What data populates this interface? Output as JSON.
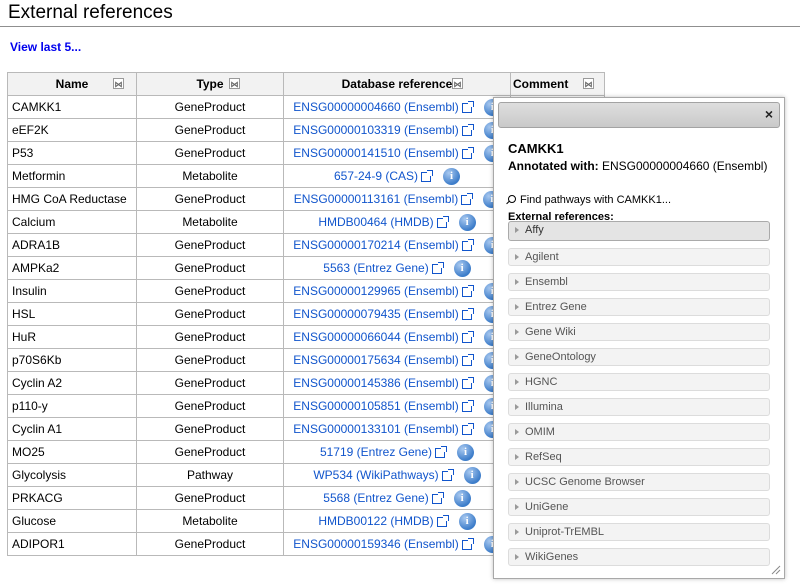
{
  "page": {
    "title": "External references",
    "view_last": "View last 5..."
  },
  "table": {
    "headers": {
      "name": "Name",
      "type": "Type",
      "dbref": "Database reference",
      "comment": "Comment"
    },
    "rows": [
      {
        "name": "CAMKK1",
        "type": "GeneProduct",
        "dbref": "ENSG00000004660 (Ensembl)"
      },
      {
        "name": "eEF2K",
        "type": "GeneProduct",
        "dbref": "ENSG00000103319 (Ensembl)"
      },
      {
        "name": "P53",
        "type": "GeneProduct",
        "dbref": "ENSG00000141510 (Ensembl)"
      },
      {
        "name": "Metformin",
        "type": "Metabolite",
        "dbref": "657-24-9 (CAS)"
      },
      {
        "name": "HMG CoA Reductase",
        "type": "GeneProduct",
        "dbref": "ENSG00000113161 (Ensembl)"
      },
      {
        "name": "Calcium",
        "type": "Metabolite",
        "dbref": "HMDB00464 (HMDB)"
      },
      {
        "name": "ADRA1B",
        "type": "GeneProduct",
        "dbref": "ENSG00000170214 (Ensembl)"
      },
      {
        "name": "AMPKa2",
        "type": "GeneProduct",
        "dbref": "5563 (Entrez Gene)"
      },
      {
        "name": "Insulin",
        "type": "GeneProduct",
        "dbref": "ENSG00000129965 (Ensembl)"
      },
      {
        "name": "HSL",
        "type": "GeneProduct",
        "dbref": "ENSG00000079435 (Ensembl)"
      },
      {
        "name": "HuR",
        "type": "GeneProduct",
        "dbref": "ENSG00000066044 (Ensembl)"
      },
      {
        "name": "p70S6Kb",
        "type": "GeneProduct",
        "dbref": "ENSG00000175634 (Ensembl)"
      },
      {
        "name": "Cyclin A2",
        "type": "GeneProduct",
        "dbref": "ENSG00000145386 (Ensembl)"
      },
      {
        "name": "p110-y",
        "type": "GeneProduct",
        "dbref": "ENSG00000105851 (Ensembl)"
      },
      {
        "name": "Cyclin A1",
        "type": "GeneProduct",
        "dbref": "ENSG00000133101 (Ensembl)"
      },
      {
        "name": "MO25",
        "type": "GeneProduct",
        "dbref": "51719 (Entrez Gene)"
      },
      {
        "name": "Glycolysis",
        "type": "Pathway",
        "dbref": "WP534 (WikiPathways)"
      },
      {
        "name": "PRKACG",
        "type": "GeneProduct",
        "dbref": "5568 (Entrez Gene)"
      },
      {
        "name": "Glucose",
        "type": "Metabolite",
        "dbref": "HMDB00122 (HMDB)"
      },
      {
        "name": "ADIPOR1",
        "type": "GeneProduct",
        "dbref": "ENSG00000159346 (Ensembl)"
      }
    ]
  },
  "popup": {
    "close": "×",
    "title": "CAMKK1",
    "annotated_label": "Annotated with:",
    "annotated_value": "ENSG00000004660 (Ensembl)",
    "find_pathways": "Find pathways with CAMKK1...",
    "ext_refs_label": "External references:",
    "sections": [
      "Affy",
      "Agilent",
      "Ensembl",
      "Entrez Gene",
      "Gene Wiki",
      "GeneOntology",
      "HGNC",
      "Illumina",
      "OMIM",
      "RefSeq",
      "UCSC Genome Browser",
      "UniGene",
      "Uniprot-TrEMBL",
      "WikiGenes"
    ]
  },
  "icons": {
    "info": "info-icon",
    "external_link": "external-link-icon",
    "sort": "sort-icon"
  }
}
